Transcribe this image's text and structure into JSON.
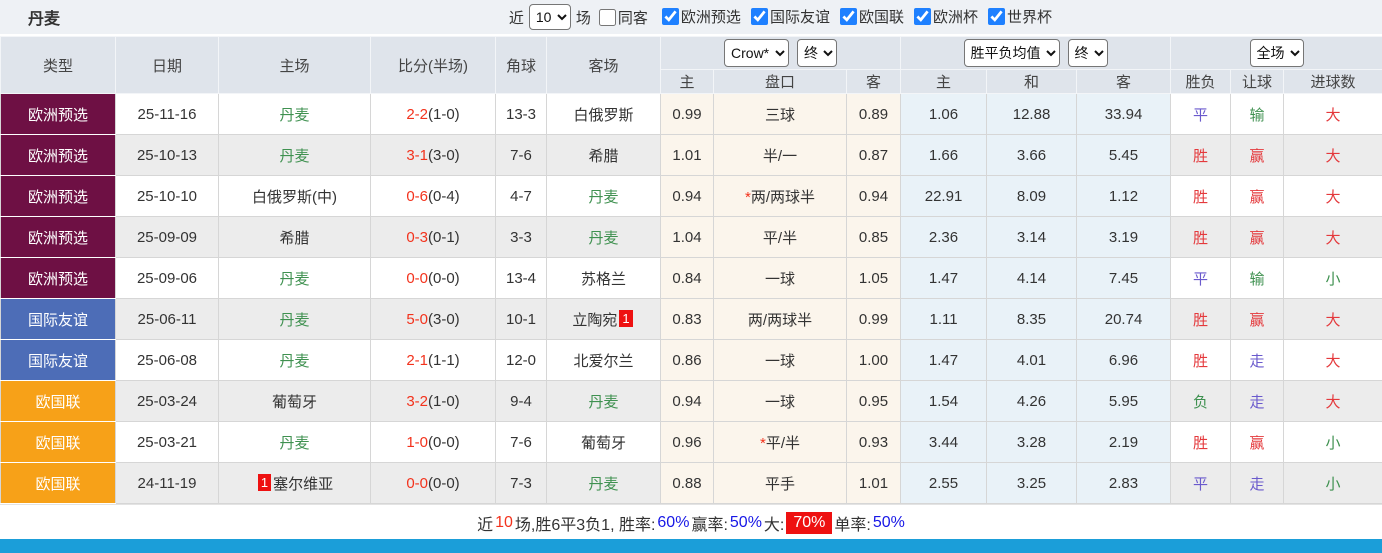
{
  "topbar": {
    "title": "丹麦",
    "recent_label": "近",
    "recent_value": "10",
    "matches_label": "场",
    "same_venue": {
      "label": "同客",
      "checked": false
    },
    "filters": [
      {
        "label": "欧洲预选",
        "checked": true
      },
      {
        "label": "国际友谊",
        "checked": true
      },
      {
        "label": "欧国联",
        "checked": true
      },
      {
        "label": "欧洲杯",
        "checked": true
      },
      {
        "label": "世界杯",
        "checked": true
      }
    ]
  },
  "table": {
    "static_columns": [
      "类型",
      "日期",
      "主场",
      "比分(半场)",
      "角球",
      "客场"
    ],
    "odds_group": {
      "bookmaker": "Crow*",
      "time": "终",
      "sub": [
        "主",
        "盘口",
        "客"
      ]
    },
    "avg_group": {
      "name": "胜平负均值",
      "time": "终",
      "sub": [
        "主",
        "和",
        "客"
      ]
    },
    "result_group": {
      "scope": "全场",
      "sub": [
        "胜负",
        "让球",
        "进球数"
      ]
    },
    "rows": [
      {
        "league": "欧洲预选",
        "date": "25-11-16",
        "home": {
          "name": "丹麦",
          "focus": true
        },
        "away": {
          "name": "白俄罗斯",
          "focus": false
        },
        "score": "2-2",
        "half": "(1-0)",
        "corner": "13-3",
        "odds": [
          "0.99",
          "三球",
          "0.89"
        ],
        "handicap_star": false,
        "avg": [
          "1.06",
          "12.88",
          "33.94"
        ],
        "result": [
          "平",
          "输",
          "大"
        ]
      },
      {
        "league": "欧洲预选",
        "date": "25-10-13",
        "home": {
          "name": "丹麦",
          "focus": true
        },
        "away": {
          "name": "希腊",
          "focus": false
        },
        "score": "3-1",
        "half": "(3-0)",
        "corner": "7-6",
        "odds": [
          "1.01",
          "半/一",
          "0.87"
        ],
        "handicap_star": false,
        "avg": [
          "1.66",
          "3.66",
          "5.45"
        ],
        "result": [
          "胜",
          "赢",
          "大"
        ]
      },
      {
        "league": "欧洲预选",
        "date": "25-10-10",
        "home": {
          "name": "白俄罗斯(中)",
          "focus": false
        },
        "away": {
          "name": "丹麦",
          "focus": true
        },
        "score": "0-6",
        "half": "(0-4)",
        "corner": "4-7",
        "odds": [
          "0.94",
          "两/两球半",
          "0.94"
        ],
        "handicap_star": true,
        "avg": [
          "22.91",
          "8.09",
          "1.12"
        ],
        "result": [
          "胜",
          "赢",
          "大"
        ]
      },
      {
        "league": "欧洲预选",
        "date": "25-09-09",
        "home": {
          "name": "希腊",
          "focus": false
        },
        "away": {
          "name": "丹麦",
          "focus": true
        },
        "score": "0-3",
        "half": "(0-1)",
        "corner": "3-3",
        "odds": [
          "1.04",
          "平/半",
          "0.85"
        ],
        "handicap_star": false,
        "avg": [
          "2.36",
          "3.14",
          "3.19"
        ],
        "result": [
          "胜",
          "赢",
          "大"
        ]
      },
      {
        "league": "欧洲预选",
        "date": "25-09-06",
        "home": {
          "name": "丹麦",
          "focus": true
        },
        "away": {
          "name": "苏格兰",
          "focus": false
        },
        "score": "0-0",
        "half": "(0-0)",
        "corner": "13-4",
        "odds": [
          "0.84",
          "一球",
          "1.05"
        ],
        "handicap_star": false,
        "avg": [
          "1.47",
          "4.14",
          "7.45"
        ],
        "result": [
          "平",
          "输",
          "小"
        ]
      },
      {
        "league": "国际友谊",
        "date": "25-06-11",
        "home": {
          "name": "丹麦",
          "focus": true
        },
        "away": {
          "name": "立陶宛",
          "focus": false,
          "badge": "1",
          "badge_pos": "after"
        },
        "score": "5-0",
        "half": "(3-0)",
        "corner": "10-1",
        "odds": [
          "0.83",
          "两/两球半",
          "0.99"
        ],
        "handicap_star": false,
        "avg": [
          "1.11",
          "8.35",
          "20.74"
        ],
        "result": [
          "胜",
          "赢",
          "大"
        ]
      },
      {
        "league": "国际友谊",
        "date": "25-06-08",
        "home": {
          "name": "丹麦",
          "focus": true
        },
        "away": {
          "name": "北爱尔兰",
          "focus": false
        },
        "score": "2-1",
        "half": "(1-1)",
        "corner": "12-0",
        "odds": [
          "0.86",
          "一球",
          "1.00"
        ],
        "handicap_star": false,
        "avg": [
          "1.47",
          "4.01",
          "6.96"
        ],
        "result": [
          "胜",
          "走",
          "大"
        ]
      },
      {
        "league": "欧国联",
        "date": "25-03-24",
        "home": {
          "name": "葡萄牙",
          "focus": false
        },
        "away": {
          "name": "丹麦",
          "focus": true
        },
        "score": "3-2",
        "half": "(1-0)",
        "corner": "9-4",
        "odds": [
          "0.94",
          "一球",
          "0.95"
        ],
        "handicap_star": false,
        "avg": [
          "1.54",
          "4.26",
          "5.95"
        ],
        "result": [
          "负",
          "走",
          "大"
        ]
      },
      {
        "league": "欧国联",
        "date": "25-03-21",
        "home": {
          "name": "丹麦",
          "focus": true
        },
        "away": {
          "name": "葡萄牙",
          "focus": false
        },
        "score": "1-0",
        "half": "(0-0)",
        "corner": "7-6",
        "odds": [
          "0.96",
          "平/半",
          "0.93"
        ],
        "handicap_star": true,
        "avg": [
          "3.44",
          "3.28",
          "2.19"
        ],
        "result": [
          "胜",
          "赢",
          "小"
        ]
      },
      {
        "league": "欧国联",
        "date": "24-11-19",
        "home": {
          "name": "塞尔维亚",
          "focus": false,
          "badge": "1",
          "badge_pos": "before"
        },
        "away": {
          "name": "丹麦",
          "focus": true
        },
        "score": "0-0",
        "half": "(0-0)",
        "corner": "7-3",
        "odds": [
          "0.88",
          "平手",
          "1.01"
        ],
        "handicap_star": false,
        "avg": [
          "2.55",
          "3.25",
          "2.83"
        ],
        "result": [
          "平",
          "走",
          "小"
        ]
      }
    ]
  },
  "footer": {
    "segments": [
      {
        "text": "近",
        "style": "dark"
      },
      {
        "text": "10",
        "style": "red"
      },
      {
        "text": "场,胜6平3负1, 胜率:",
        "style": "dark"
      },
      {
        "text": "60%",
        "style": "blue"
      },
      {
        "text": " 赢率:",
        "style": "dark"
      },
      {
        "text": "50%",
        "style": "blue"
      },
      {
        "text": " 大:",
        "style": "dark"
      },
      {
        "text": "70%",
        "style": "redbg"
      },
      {
        "text": " 单率:",
        "style": "dark"
      },
      {
        "text": "50%",
        "style": "blue"
      }
    ]
  },
  "colors": {
    "league": {
      "欧洲预选": "#6e1044",
      "国际友谊": "#4d6db7",
      "欧国联": "#f7a118"
    },
    "team_highlight": "#3f9150",
    "score_red": "#f3321c",
    "result_red": "#e4393c",
    "result_green": "#3f9150",
    "result_blue": "#6a5acd",
    "footer_link_blue": "#1717e6",
    "highlight_badge_red": "#ee1111",
    "bottom_bar_blue": "#1b9ed9"
  }
}
